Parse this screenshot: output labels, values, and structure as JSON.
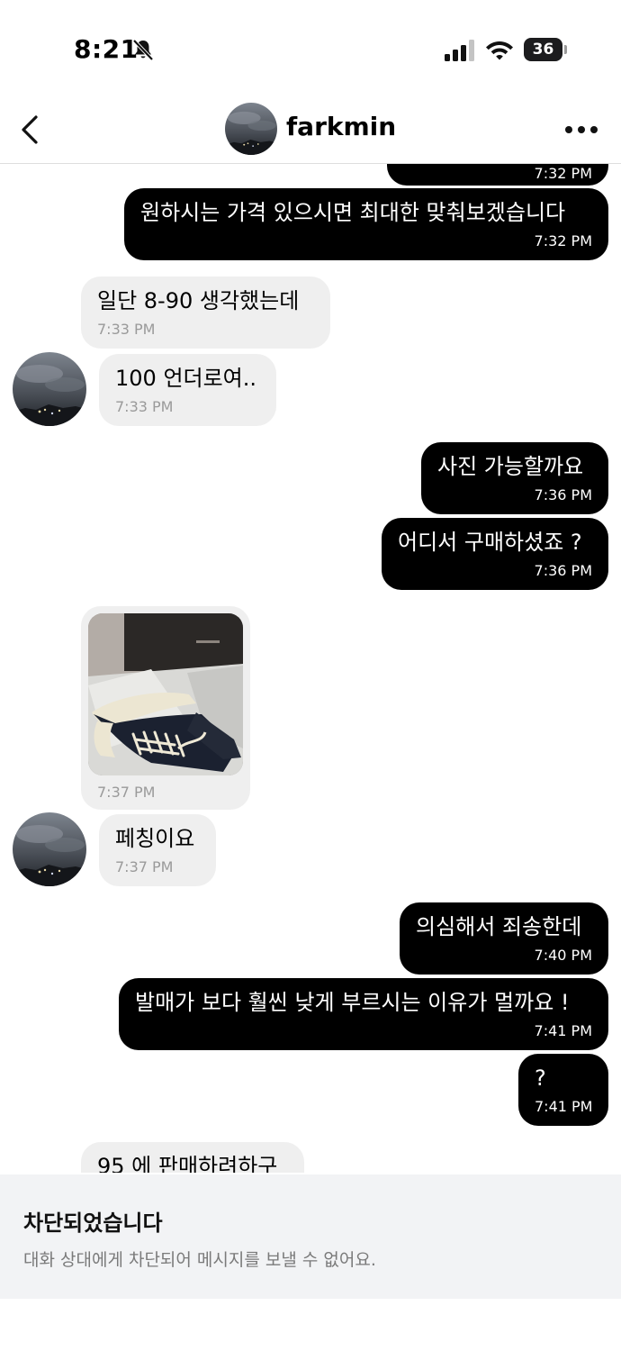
{
  "status_bar": {
    "time": "8:21",
    "battery": "36",
    "battery_level": 0.36,
    "icons": [
      "bell-slash-icon",
      "cellular-signal-icon",
      "wifi-icon",
      "battery-icon"
    ]
  },
  "header": {
    "username": "farkmin",
    "icons": [
      "chevron-left-icon",
      "more-horizontal-icon"
    ]
  },
  "messages": [
    {
      "dir": "out",
      "text": "",
      "time": "7:32 PM",
      "partial": true
    },
    {
      "dir": "out",
      "text": "원하시는 가격 있으시면 최대한 맞춰보겠습니다",
      "time": "7:32 PM"
    },
    {
      "dir": "in",
      "text": "일단 8-90 생각했는데",
      "time": "7:33 PM"
    },
    {
      "dir": "in",
      "text": "100 언더로여..",
      "time": "7:33 PM"
    },
    {
      "dir": "out",
      "text": "사진 가능할까요",
      "time": "7:36 PM"
    },
    {
      "dir": "out",
      "text": "어디서 구매하셨죠 ?",
      "time": "7:36 PM"
    },
    {
      "dir": "in",
      "type": "image",
      "time": "7:37 PM"
    },
    {
      "dir": "in",
      "text": "페칭이요",
      "time": "7:37 PM"
    },
    {
      "dir": "out",
      "text": "의심해서 죄송한데",
      "time": "7:40 PM"
    },
    {
      "dir": "out",
      "text": "발매가 보다 훨씬 낮게 부르시는 이유가 멀까요 !",
      "time": "7:41 PM"
    },
    {
      "dir": "out",
      "text": "?",
      "time": "7:41 PM"
    },
    {
      "dir": "in",
      "text": "95 에 판매하려하구",
      "time": "",
      "partial": true
    }
  ],
  "blocked": {
    "title": "차단되었습니다",
    "description": "대화 상대에게 차단되어 메시지를 보낼 수 없어요."
  },
  "colors": {
    "outgoing_bubble": "#000000",
    "incoming_bubble": "#efefef",
    "timestamp_incoming": "#9a9a9a",
    "banner_bg": "#f2f3f5"
  }
}
